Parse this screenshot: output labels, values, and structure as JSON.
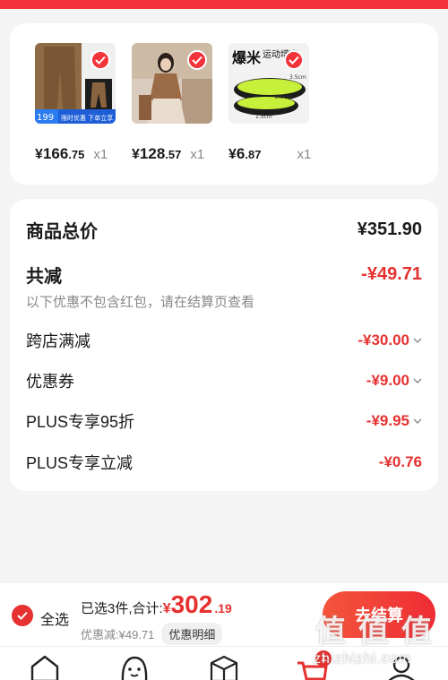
{
  "products": [
    {
      "price_yen": "¥",
      "price_int": "166",
      "price_dec": ".75",
      "qty": "x1",
      "promo_price": "199",
      "promo_text": "限时优惠 下单立享"
    },
    {
      "price_yen": "¥",
      "price_int": "128",
      "price_dec": ".57",
      "qty": "x1"
    },
    {
      "price_yen": "¥",
      "price_int": "6",
      "price_dec": ".87",
      "qty": "x1",
      "promo_title": "运动增高",
      "promo_big": "爆米",
      "sizes": [
        "3.5cm",
        "2.5cm",
        "1.5cm"
      ]
    }
  ],
  "summary": {
    "total_label": "商品总价",
    "total_value": "¥351.90",
    "reduce_label": "共减",
    "reduce_value": "-¥49.71",
    "reduce_note": "以下优惠不包含红包，请在结算页查看",
    "items": [
      {
        "label": "跨店满减",
        "value": "-¥30.00",
        "has_chevron": true
      },
      {
        "label": "优惠券",
        "value": "-¥9.00",
        "has_chevron": true
      },
      {
        "label": "PLUS专享95折",
        "value": "-¥9.95",
        "has_chevron": true
      },
      {
        "label": "PLUS专享立减",
        "value": "-¥0.76",
        "has_chevron": false
      }
    ]
  },
  "bottom_bar": {
    "select_all_label": "全选",
    "selected_label": "已选3件,合计:",
    "total_yen": "¥",
    "total_int": "302",
    "total_dec": ".19",
    "discount_label": "优惠减:¥49.71",
    "discount_detail_button": "优惠明细",
    "checkout_button": "去结算"
  },
  "watermark": {
    "glyphs": [
      "值",
      "值",
      "值"
    ],
    "url": "zhizhizhi.com"
  },
  "tabbar": {
    "cart_badge": "1",
    "icons": [
      "home-icon",
      "face-icon",
      "box-icon",
      "cart-icon",
      "user-icon"
    ]
  },
  "colors": {
    "accent": "#e5312f",
    "brand_red": "#f2333a",
    "background": "#f4f4f5",
    "insole_green": "#c6f03a"
  }
}
